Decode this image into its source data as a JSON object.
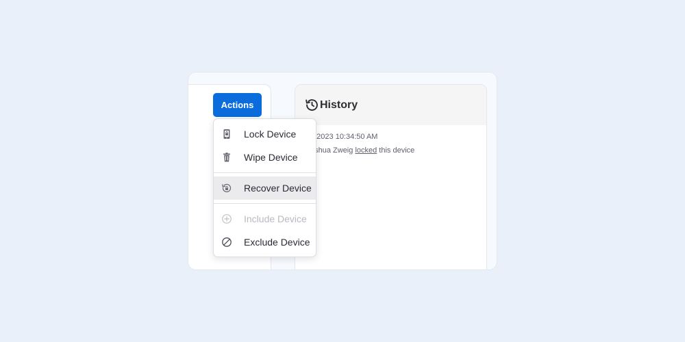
{
  "toolbar": {
    "actions_label": "Actions"
  },
  "history": {
    "title": "History",
    "entries": [
      {
        "timestamp": "0/2023 10:34:50 AM",
        "actor": "oshua Zweig",
        "action": "locked",
        "target": "this device"
      }
    ]
  },
  "actions_menu": {
    "items": [
      {
        "label": "Lock Device",
        "icon": "phone-lock-icon",
        "state": "normal"
      },
      {
        "label": "Wipe Device",
        "icon": "trash-icon",
        "state": "normal"
      },
      {
        "label": "Recover Device",
        "icon": "recover-icon",
        "state": "highlighted"
      },
      {
        "label": "Include Device",
        "icon": "plus-circle-icon",
        "state": "disabled"
      },
      {
        "label": "Exclude Device",
        "icon": "ban-icon",
        "state": "normal"
      }
    ]
  },
  "colors": {
    "page_background": "#eaf0f9",
    "accent": "#0a6ddb",
    "highlight_row": "#ebebee",
    "disabled_text": "#b9b9c2"
  }
}
